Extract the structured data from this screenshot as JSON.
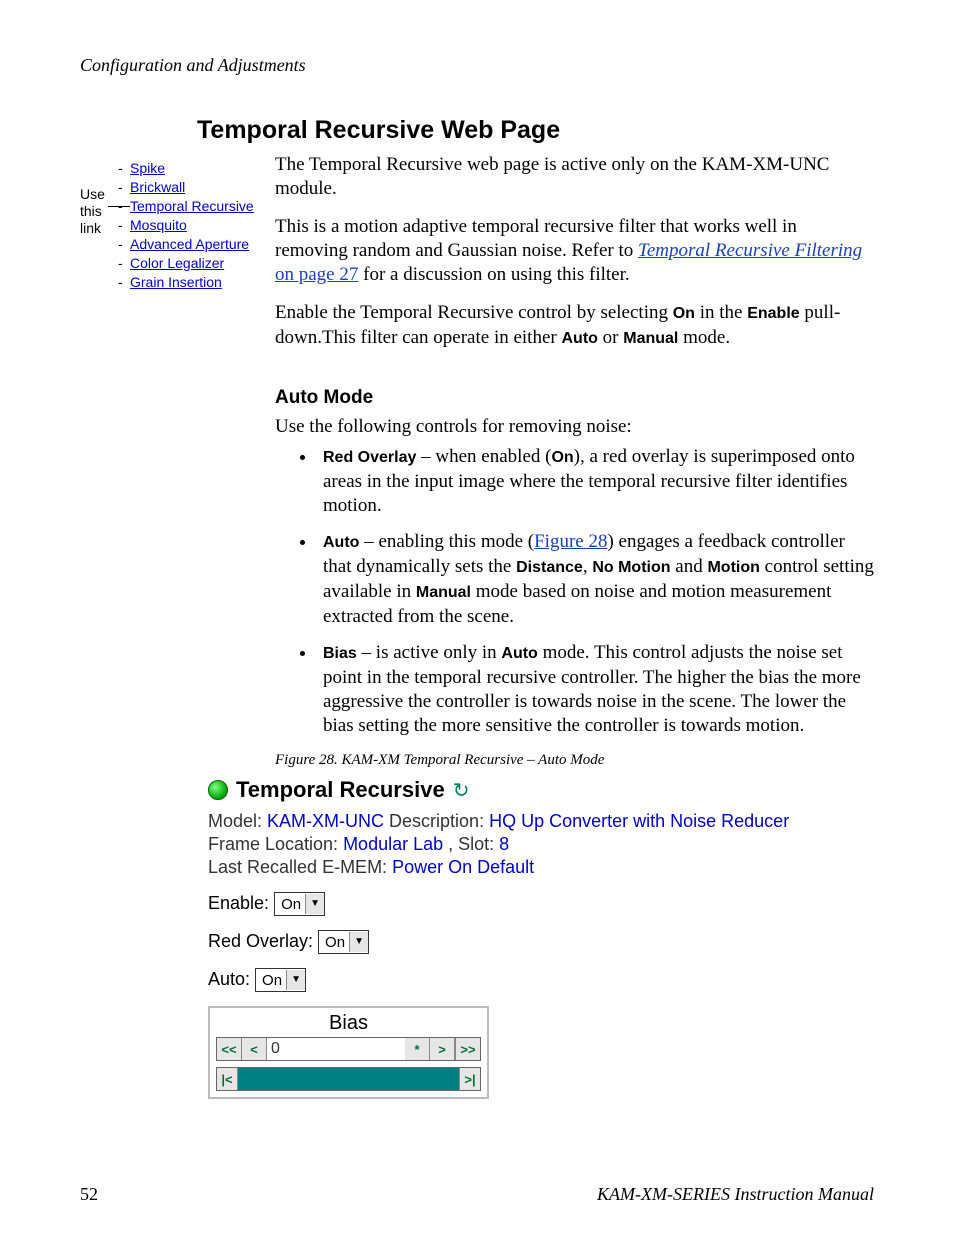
{
  "header": {
    "section": "Configuration and Adjustments"
  },
  "title": "Temporal Recursive Web Page",
  "sidenote": {
    "l1": "Use",
    "l2": "this",
    "l3": "link"
  },
  "nav": {
    "items": [
      {
        "label": "Spike"
      },
      {
        "label": "Brickwall"
      },
      {
        "label": "Temporal Recursive"
      },
      {
        "label": "Mosquito"
      },
      {
        "label": "Advanced Aperture"
      },
      {
        "label": "Color Legalizer"
      },
      {
        "label": "Grain Insertion"
      }
    ]
  },
  "body": {
    "p1": "The Temporal Recursive web page is active only on the KAM-XM-UNC module.",
    "p2a": "This is a motion adaptive temporal recursive filter that works well in removing random and Gaussian noise. Refer to ",
    "p2_link": "Temporal Recursive Filtering",
    "p2_link2": " on page 27",
    "p2b": " for a discussion on using this filter.",
    "p3a": "Enable the Temporal Recursive control by selecting ",
    "p3_on": "On",
    "p3b": " in the ",
    "p3_enable": "Enable",
    "p3c": " pull-down.This filter can operate in either ",
    "p3_auto": "Auto",
    "p3d": " or ",
    "p3_manual": "Manual",
    "p3e": " mode."
  },
  "auto": {
    "heading": "Auto Mode",
    "intro": "Use the following controls for removing noise:",
    "b1_label": "Red Overlay",
    "b1_a": " – when enabled (",
    "b1_on": "On",
    "b1_b": "), a red overlay is superimposed onto areas in the input image where the temporal recursive filter identifies motion.",
    "b2_label": "Auto",
    "b2_a": " – enabling this mode (",
    "b2_link": "Figure 28",
    "b2_b": ") engages a feedback controller that dynamically sets the ",
    "b2_distance": "Distance",
    "b2_c": ", ",
    "b2_nomotion": "No Motion",
    "b2_d": " and ",
    "b2_motion": "Motion",
    "b2_e": " control setting available in ",
    "b2_manual": "Manual",
    "b2_f": " mode based on noise and motion measurement extracted from the scene.",
    "b3_label": "Bias",
    "b3_a": " – is active only in ",
    "b3_auto": "Auto",
    "b3_b": " mode. This control adjusts the noise set point in the temporal recursive controller. The higher the bias the more aggressive the controller is towards noise in the scene. The lower the bias setting the more sensitive the controller is towards motion."
  },
  "figure": {
    "caption": "Figure 28.  KAM-XM Temporal Recursive – Auto Mode"
  },
  "panel": {
    "title": "Temporal Recursive",
    "model_label": "Model: ",
    "model_value": "KAM-XM-UNC",
    "desc_label": " Description: ",
    "desc_value": "HQ Up Converter with Noise Reducer",
    "frame_label": "Frame Location: ",
    "frame_value": "Modular Lab",
    "slot_label": " , Slot: ",
    "slot_value": "8",
    "emem_label": "Last Recalled E-MEM: ",
    "emem_value": "Power On Default",
    "enable_label": "Enable: ",
    "enable_value": "On",
    "redoverlay_label": "Red Overlay: ",
    "redoverlay_value": "On",
    "auto_label": "Auto: ",
    "auto_value": "On",
    "bias_title": "Bias",
    "bias_value": "0",
    "btn_rewind": "<<",
    "btn_back": "<",
    "btn_reset": "*",
    "btn_fwd": ">",
    "btn_ffwd": ">>",
    "btn_sl_left": "|<",
    "btn_sl_right": ">|"
  },
  "footer": {
    "page": "52",
    "manual": "KAM-XM-SERIES Instruction Manual"
  }
}
